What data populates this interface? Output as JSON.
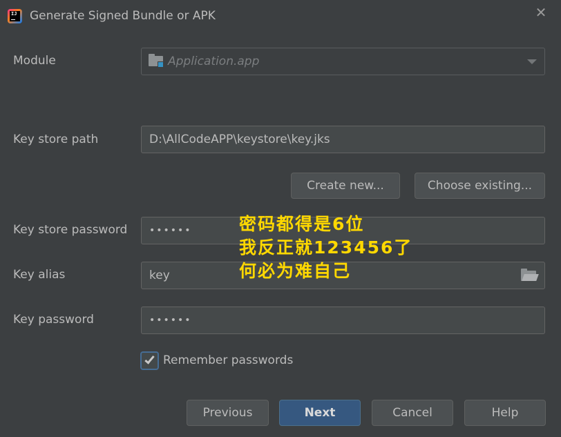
{
  "window": {
    "title": "Generate Signed Bundle or APK",
    "app_icon_text": "IJ",
    "close_symbol": "✕"
  },
  "module": {
    "label": "Module",
    "value": "Application.app",
    "icon": "module-folder-icon"
  },
  "key_store_path": {
    "label": "Key store path",
    "value": "D:\\AllCodeAPP\\keystore\\key.jks"
  },
  "buttons_keystore": {
    "create_new": "Create new...",
    "choose_existing": "Choose existing..."
  },
  "key_store_password": {
    "label": "Key store password",
    "value": "••••••"
  },
  "key_alias": {
    "label": "Key alias",
    "value": "key",
    "icon": "folder-open-icon"
  },
  "key_password": {
    "label": "Key password",
    "value": "••••••"
  },
  "remember": {
    "label": "Remember passwords",
    "checked": true
  },
  "footer": {
    "previous": "Previous",
    "next": "Next",
    "cancel": "Cancel",
    "help": "Help"
  },
  "annotation": {
    "line1": "密码都得是6位",
    "line2": "我反正就123456了",
    "line3": "何必为难自己"
  },
  "colors": {
    "background": "#3c3f41",
    "field": "#45494a",
    "primary_button": "#365880",
    "annotation": "#ffd800"
  }
}
